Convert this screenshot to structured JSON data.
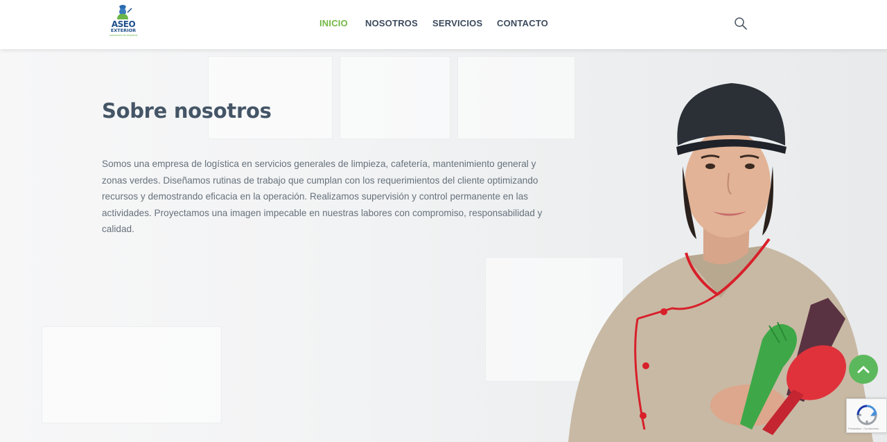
{
  "header": {
    "logo": {
      "line1": "ASEO",
      "line2": "EXTERIOR",
      "line3": "soluciones en limpieza"
    },
    "nav": [
      {
        "label": "INICIO",
        "active": true
      },
      {
        "label": "NOSOTROS",
        "active": false
      },
      {
        "label": "SERVICIOS",
        "active": false
      },
      {
        "label": "CONTACTO",
        "active": false
      }
    ],
    "search_icon": "search-icon"
  },
  "hero": {
    "title": "Sobre nosotros",
    "description": "Somos una empresa de logística en servicios generales de limpieza, cafetería, mantenimiento general y zonas verdes. Diseñamos rutinas de trabajo que cumplan con los requerimientos del cliente optimizando recursos y demostrando eficacia en la operación. Realizamos supervisión y control permanente en las actividades. Proyectamos una imagen impecable en nuestras labores con compromiso, responsabilidad y calidad."
  },
  "recaptcha": {
    "text": "Privacidad - Condiciones"
  },
  "colors": {
    "accent": "#73b843",
    "nav_text": "#3b4a5c",
    "title": "#445566",
    "body": "#66717c",
    "scroll_button": "#5cb85c"
  }
}
